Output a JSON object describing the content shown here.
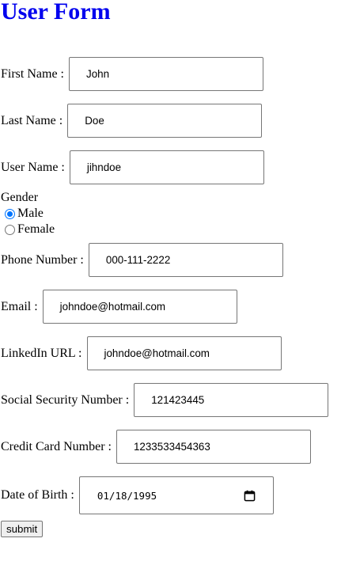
{
  "page": {
    "title": "User Form"
  },
  "form": {
    "first_name": {
      "label": "First Name :",
      "value": "John"
    },
    "last_name": {
      "label": "Last Name :",
      "value": "Doe"
    },
    "user_name": {
      "label": "User Name :",
      "value": "jihndoe"
    },
    "gender": {
      "label": "Gender",
      "options": [
        {
          "label": "Male",
          "checked": true
        },
        {
          "label": "Female",
          "checked": false
        }
      ]
    },
    "phone": {
      "label": "Phone Number :",
      "value": "000-111-2222"
    },
    "email": {
      "label": "Email :",
      "value": "johndoe@hotmail.com"
    },
    "linkedin": {
      "label": "LinkedIn URL :",
      "value": "johndoe@hotmail.com"
    },
    "ssn": {
      "label": "Social Security Number :",
      "value": "121423445"
    },
    "credit_card": {
      "label": "Credit Card Number :",
      "value": "1233533454363"
    },
    "dob": {
      "label": "Date of Birth :",
      "value": "01/18/1995",
      "icon": "calendar-icon"
    },
    "submit_label": "submit"
  },
  "colors": {
    "title": "#0000ee",
    "radio_accent": "#0075ff",
    "input_border": "#767676",
    "button_bg": "#efefef"
  }
}
